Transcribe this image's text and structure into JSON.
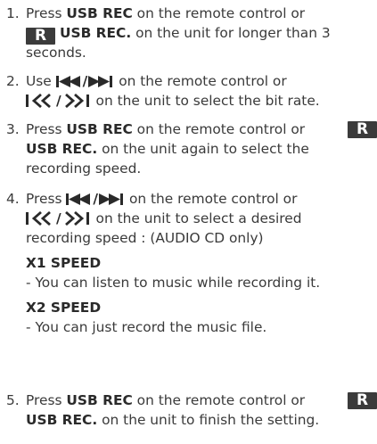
{
  "steps": [
    {
      "number": "1.",
      "press": "Press",
      "usb_rec": "USB REC",
      "remote_tail": "on the remote control or",
      "badge": "R",
      "usb_rec_dot": "USB REC.",
      "unit_tail": "on the unit for longer than 3",
      "line3": "seconds."
    },
    {
      "number": "2.",
      "use": "Use",
      "remote_tail": "on the remote control or",
      "unit_tail": "on the unit to select the bit rate."
    },
    {
      "number": "3.",
      "press": "Press",
      "usb_rec": "USB REC",
      "remote_tail": "on the remote control or",
      "badge": "R",
      "usb_rec_dot": "USB REC.",
      "unit_tail": "on the unit again to select the",
      "line3": "recording speed."
    },
    {
      "number": "4.",
      "press": "Press",
      "remote_tail": "on the remote control or",
      "unit_tail": "on the unit to select a desired",
      "line3": "recording speed : (AUDIO CD only)",
      "options": [
        {
          "title": "X1 SPEED",
          "desc": "- You can listen to music while recording it."
        },
        {
          "title": "X2 SPEED",
          "desc": "- You can just record the music file."
        }
      ]
    },
    {
      "number": "5.",
      "press": "Press",
      "usb_rec": "USB REC",
      "remote_tail": "on the remote control or",
      "badge": "R",
      "usb_rec_dot": "USB REC.",
      "unit_tail": "on the unit to finish the setting."
    }
  ],
  "glyphs": {
    "slash": "/",
    "unit_skip_left": "I<<",
    "unit_skip_right": ">>I"
  },
  "colors": {
    "text": "#3a3a3a",
    "badge_bg": "#3b3b3b",
    "badge_fg": "#ffffff"
  }
}
